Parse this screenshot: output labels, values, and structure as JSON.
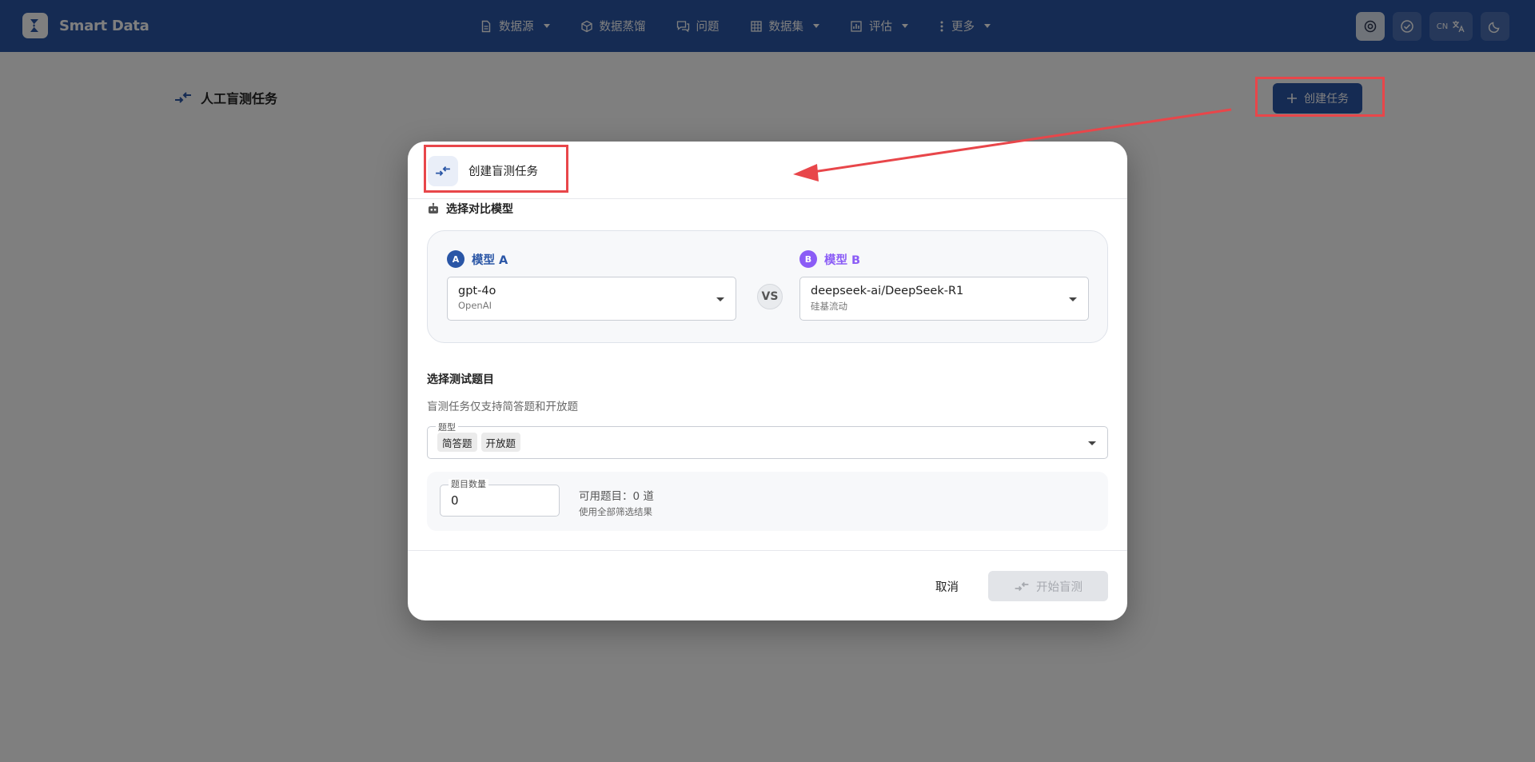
{
  "brand": {
    "name": "Smart Data"
  },
  "nav": {
    "items": [
      {
        "label": "数据源",
        "icon": "document-icon",
        "dropdown": true
      },
      {
        "label": "数据蒸馏",
        "icon": "cube-icon",
        "dropdown": false
      },
      {
        "label": "问题",
        "icon": "chat-icon",
        "dropdown": false
      },
      {
        "label": "数据集",
        "icon": "grid-icon",
        "dropdown": true
      },
      {
        "label": "评估",
        "icon": "chart-icon",
        "dropdown": true
      },
      {
        "label": "更多",
        "icon": "more-icon",
        "dropdown": true
      }
    ]
  },
  "tools": {
    "lang_code": "CN"
  },
  "page": {
    "title": "人工盲测任务",
    "create_button": "创建任务"
  },
  "dialog": {
    "title": "创建盲测任务",
    "model_section": "选择对比模型",
    "model_a": {
      "badge": "A",
      "label": "模型 A",
      "name": "gpt-4o",
      "provider": "OpenAI"
    },
    "vs": "VS",
    "model_b": {
      "badge": "B",
      "label": "模型 B",
      "name": "deepseek-ai/DeepSeek-R1",
      "provider": "硅基流动"
    },
    "question_section": "选择测试题目",
    "hint": "盲测任务仅支持简答题和开放题",
    "question_type": {
      "legend": "题型",
      "chips": [
        "简答题",
        "开放题"
      ]
    },
    "count": {
      "legend": "题目数量",
      "value": "0",
      "available": "可用题目：0 道",
      "available_sub": "使用全部筛选结果"
    },
    "cancel": "取消",
    "start": "开始盲测"
  },
  "colors": {
    "primary": "#2a56a6",
    "model_a": "#2a56a6",
    "model_b": "#8b5cf6",
    "highlight": "#e8464a"
  }
}
